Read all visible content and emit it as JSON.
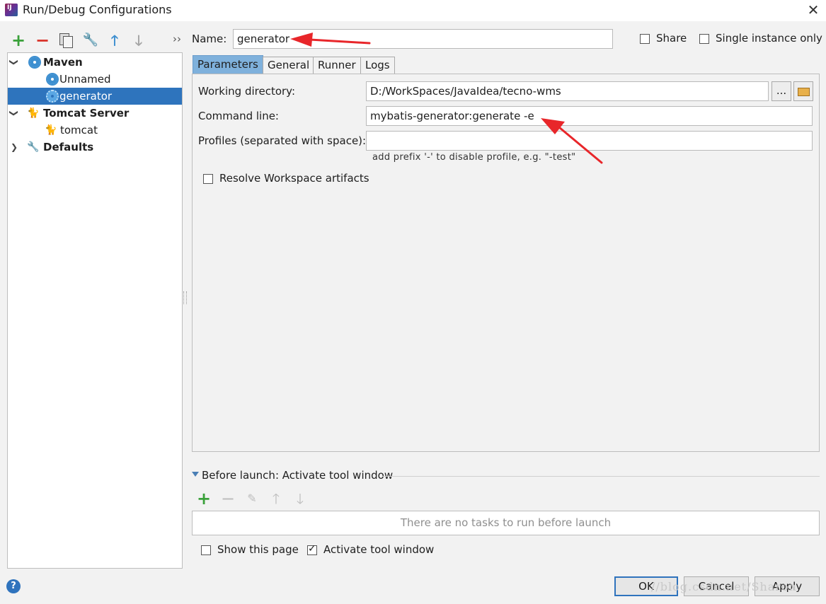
{
  "window": {
    "title": "Run/Debug Configurations",
    "app_icon_text": "IJ"
  },
  "toolbar": {
    "more_label": "››"
  },
  "tree": {
    "items": [
      {
        "label": "Maven",
        "bold": true
      },
      {
        "label": "Unnamed"
      },
      {
        "label": "generator",
        "selected": true
      },
      {
        "label": "Tomcat Server",
        "bold": true
      },
      {
        "label": "tomcat"
      },
      {
        "label": "Defaults",
        "bold": true
      }
    ]
  },
  "name_row": {
    "label": "Name:",
    "value": "generator"
  },
  "share": {
    "label": "Share",
    "checked": false
  },
  "single_instance": {
    "label": "Single instance only",
    "checked": false
  },
  "tabs": [
    {
      "label": "Parameters",
      "active": true
    },
    {
      "label": "General"
    },
    {
      "label": "Runner"
    },
    {
      "label": "Logs"
    }
  ],
  "parameters": {
    "working_dir_label": "Working directory:",
    "working_dir_value": "D:/WorkSpaces/JavaIdea/tecno-wms",
    "browse_label": "...",
    "command_line_label": "Command line:",
    "command_line_value": "mybatis-generator:generate -e",
    "profiles_label": "Profiles (separated with space):",
    "profiles_value": "",
    "profiles_hint": "add prefix '-' to disable profile, e.g. \"-test\"",
    "resolve_label": "Resolve Workspace artifacts",
    "resolve_checked": false
  },
  "before_launch": {
    "title": "Before launch: Activate tool window",
    "empty_text": "There are no tasks to run before launch",
    "show_page_label": "Show this page",
    "show_page_checked": false,
    "activate_label": "Activate tool window",
    "activate_checked": true
  },
  "buttons": {
    "ok": "OK",
    "cancel": "Cancel",
    "apply": "Apply"
  },
  "help": {
    "glyph": "?"
  },
  "watermark": "//blog.csdn.net/Sharon",
  "colors": {
    "accent": "#2e74bd",
    "tab_active": "#7fb1dc",
    "arrow": "#e8262a",
    "add": "#3aa13a",
    "remove": "#d9342b"
  }
}
